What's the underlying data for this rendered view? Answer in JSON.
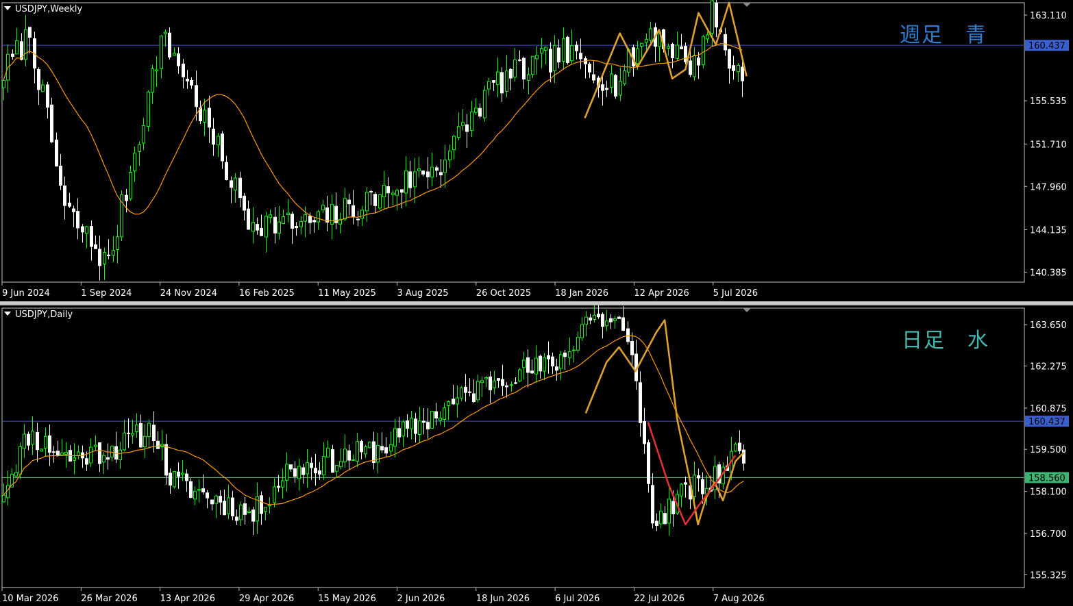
{
  "colors": {
    "background": "#000000",
    "bull": "#00ff00",
    "bear": "#ffffff",
    "ma": "#ff9900",
    "zigzag": "#e0a030",
    "zigzag_red": "#e03030",
    "level_line": "#4050e0",
    "level_line_green": "#60c080",
    "note_blue": "#2a7fd4",
    "note_cyan": "#40b8b0"
  },
  "weekly": {
    "symbol": "USDJPY,Weekly",
    "note": "週足　青",
    "price_labels": [
      "163.110",
      "155.535",
      "151.710",
      "147.960",
      "144.135",
      "140.385"
    ],
    "price_min": 139.5,
    "price_max": 164.2,
    "level_value": 160.437,
    "level_label": "160.437",
    "time_labels": [
      "9 Jun 2024",
      "1 Sep 2024",
      "24 Nov 2024",
      "16 Feb 2025",
      "11 May 2025",
      "3 Aug 2025",
      "26 Oct 2025",
      "18 Jan 2026",
      "12 Apr 2026",
      "5 Jul 2026"
    ]
  },
  "daily": {
    "symbol": "USDJPY,Daily",
    "note": "日足　水",
    "price_labels": [
      "163.650",
      "162.275",
      "160.875",
      "159.500",
      "158.100",
      "156.700",
      "155.325"
    ],
    "price_min": 154.9,
    "price_max": 164.2,
    "level_value": 160.437,
    "level_label": "160.437",
    "level2_value": 158.56,
    "level2_label": "158.560",
    "time_labels": [
      "10 Mar 2026",
      "26 Mar 2026",
      "13 Apr 2026",
      "29 Apr 2026",
      "15 May 2026",
      "2 Jun 2026",
      "18 Jun 2026",
      "6 Jul 2026",
      "22 Jul 2026",
      "7 Aug 2026"
    ]
  }
}
